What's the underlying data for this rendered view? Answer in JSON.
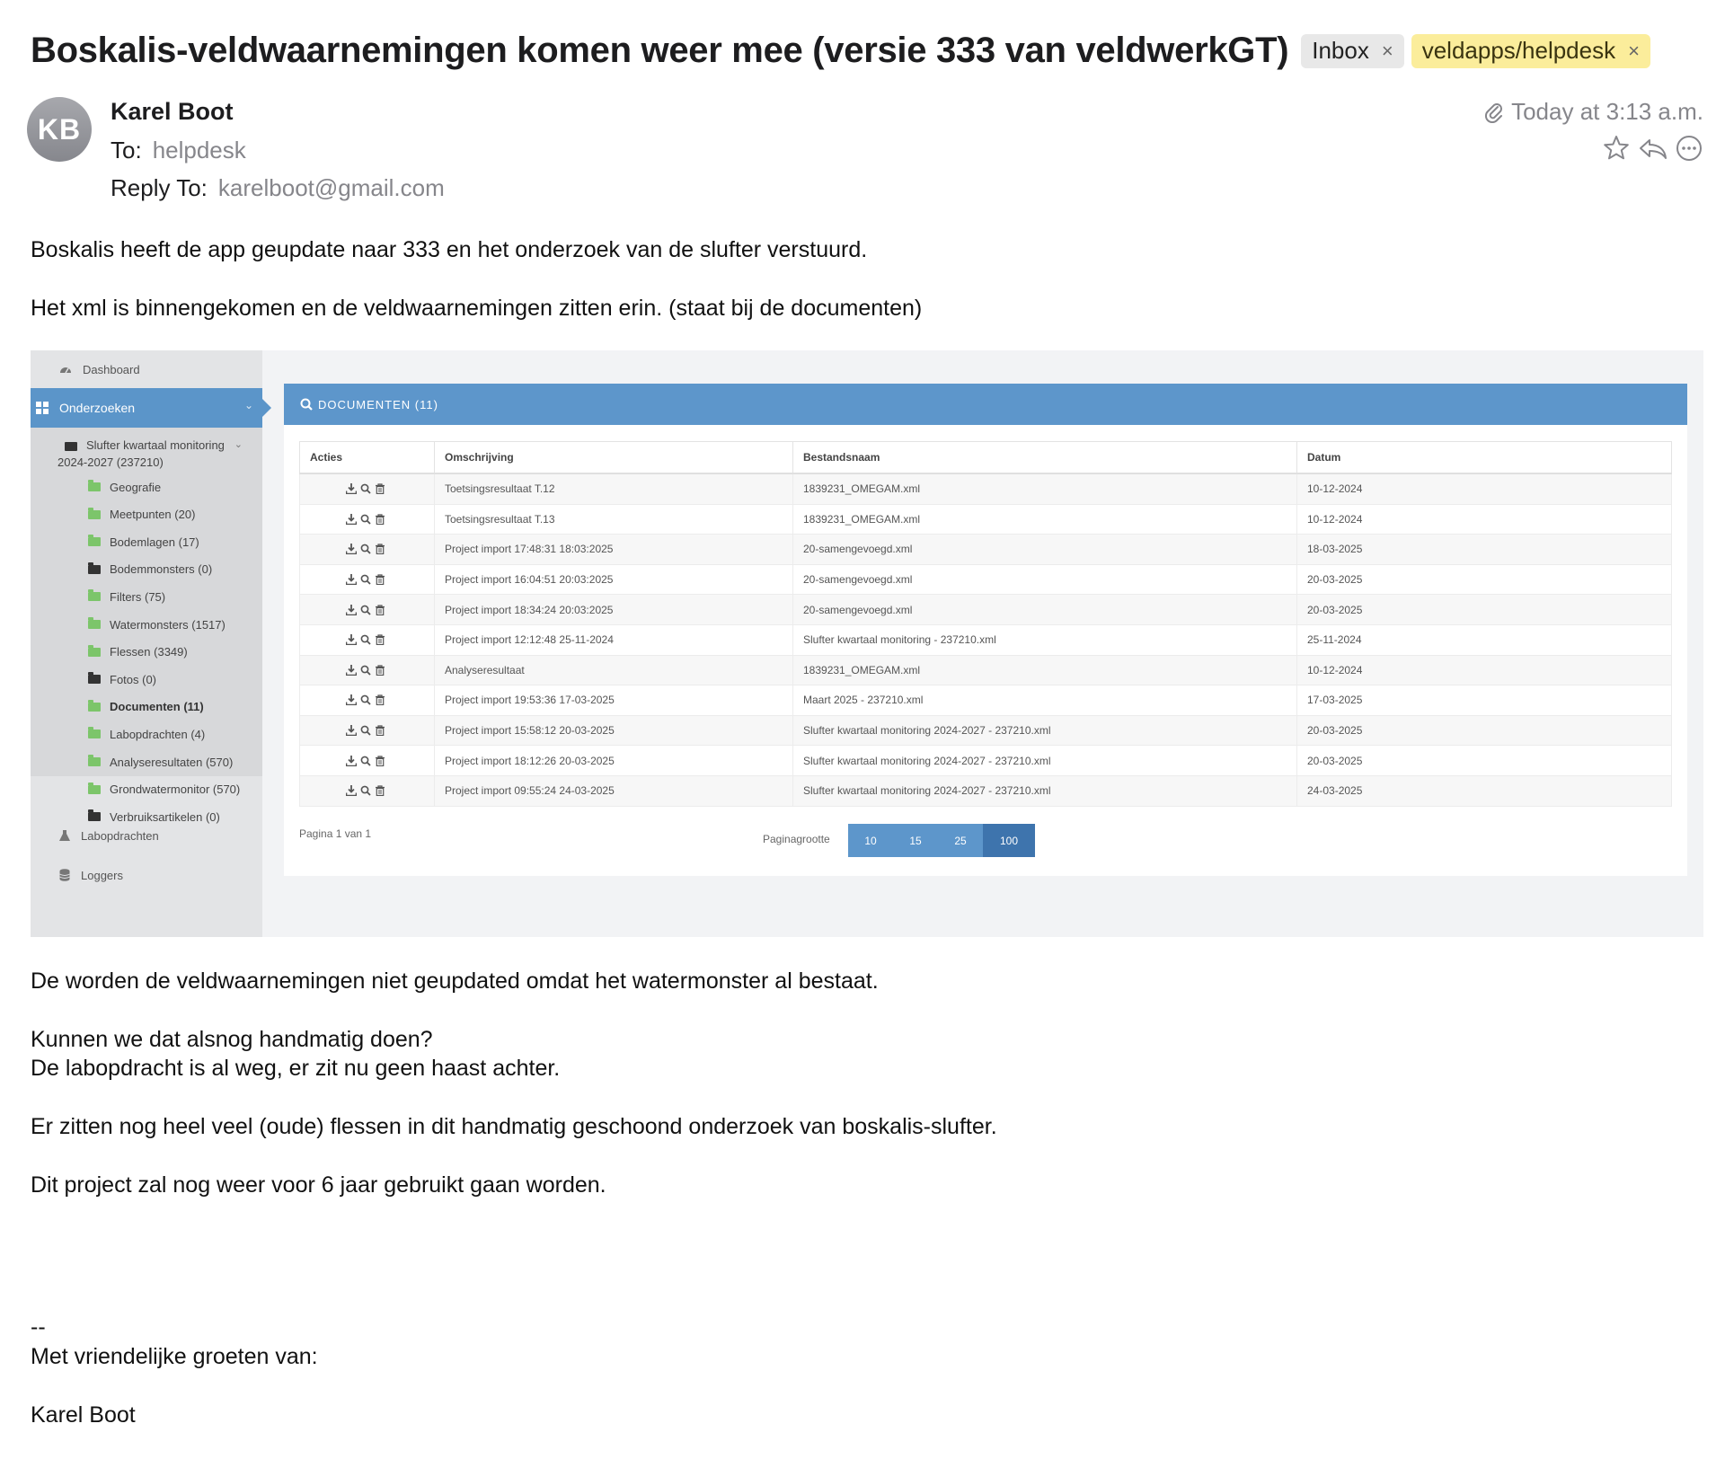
{
  "email": {
    "subject": "Boskalis-veldwaarnemingen komen weer mee (versie 333 van veldwerkGT)",
    "tags": [
      {
        "label": "Inbox",
        "close": "×"
      },
      {
        "label": "veldapps/helpdesk",
        "close": "×",
        "color": "#fbed9b"
      }
    ],
    "avatar_initials": "KB",
    "sender": "Karel Boot",
    "to_label": "To:",
    "to_value": "helpdesk",
    "reply_to_label": "Reply To:",
    "reply_to_value": "karelboot@gmail.com",
    "date": "Today at 3:13 a.m.",
    "icons": [
      "paperclip-icon",
      "star-icon",
      "reply-icon",
      "more-icon"
    ],
    "body_top": [
      "Boskalis heeft de app geupdate naar 333 en het onderzoek van de slufter verstuurd.",
      "Het xml is binnengekomen en de veldwaarnemingen zitten erin. (staat bij de documenten)"
    ],
    "body_bottom": [
      "De worden de veldwaarnemingen niet geupdated omdat het watermonster al bestaat.",
      "Kunnen we dat alsnog handmatig doen?",
      "De labopdracht is al weg, er zit nu geen haast achter.",
      "Er zitten nog heel veel (oude) flessen in dit handmatig geschoond onderzoek van boskalis-slufter.",
      "Dit project zal nog weer voor 6 jaar gebruikt gaan worden."
    ],
    "signature": {
      "separator": "--",
      "greeting": "Met vriendelijke groeten van:",
      "name": "Karel Boot"
    }
  },
  "screenshot": {
    "sidebar": {
      "dashboard": "Dashboard",
      "onderzoeken": "Onderzoeken",
      "project": "Slufter kwartaal monitoring 2024-2027 (237210)",
      "items": [
        {
          "label": "Geografie",
          "folder": "green"
        },
        {
          "label": "Meetpunten (20)",
          "folder": "green"
        },
        {
          "label": "Bodemlagen (17)",
          "folder": "green"
        },
        {
          "label": "Bodemmonsters (0)",
          "folder": "black"
        },
        {
          "label": "Filters (75)",
          "folder": "green"
        },
        {
          "label": "Watermonsters (1517)",
          "folder": "green"
        },
        {
          "label": "Flessen (3349)",
          "folder": "green"
        },
        {
          "label": "Fotos (0)",
          "folder": "black"
        },
        {
          "label": "Documenten (11)",
          "folder": "green",
          "active": true
        },
        {
          "label": "Labopdrachten (4)",
          "folder": "green"
        },
        {
          "label": "Analyseresultaten (570)",
          "folder": "green"
        },
        {
          "label": "Grondwatermonitor (570)",
          "folder": "green"
        },
        {
          "label": "Verbruiksartikelen (0)",
          "folder": "black"
        }
      ],
      "labopdrachten": "Labopdrachten",
      "loggers": "Loggers"
    },
    "panel_title": "DOCUMENTEN (11)",
    "table": {
      "headers": [
        "Acties",
        "Omschrijving",
        "Bestandsnaam",
        "Datum"
      ],
      "rows": [
        [
          "Toetsingsresultaat T.12",
          "1839231_OMEGAM.xml",
          "10-12-2024"
        ],
        [
          "Toetsingsresultaat T.13",
          "1839231_OMEGAM.xml",
          "10-12-2024"
        ],
        [
          "Project import 17:48:31 18:03:2025",
          "20-samengevoegd.xml",
          "18-03-2025"
        ],
        [
          "Project import 16:04:51 20:03:2025",
          "20-samengevoegd.xml",
          "20-03-2025"
        ],
        [
          "Project import 18:34:24 20:03:2025",
          "20-samengevoegd.xml",
          "20-03-2025"
        ],
        [
          "Project import 12:12:48 25-11-2024",
          "Slufter kwartaal monitoring - 237210.xml",
          "25-11-2024"
        ],
        [
          "Analyseresultaat",
          "1839231_OMEGAM.xml",
          "10-12-2024"
        ],
        [
          "Project import 19:53:36 17-03-2025",
          "Maart 2025 - 237210.xml",
          "17-03-2025"
        ],
        [
          "Project import 15:58:12 20-03-2025",
          "Slufter kwartaal monitoring 2024-2027 - 237210.xml",
          "20-03-2025"
        ],
        [
          "Project import 18:12:26 20-03-2025",
          "Slufter kwartaal monitoring 2024-2027 - 237210.xml",
          "20-03-2025"
        ],
        [
          "Project import 09:55:24 24-03-2025",
          "Slufter kwartaal monitoring 2024-2027 - 237210.xml",
          "24-03-2025"
        ]
      ],
      "row_action_icons": [
        "download-icon",
        "view-icon",
        "delete-icon"
      ]
    },
    "pager_text": "Pagina 1 van 1",
    "page_size_label": "Paginagrootte",
    "page_sizes": [
      "10",
      "15",
      "25",
      "100"
    ],
    "page_size_selected": "100",
    "accent_color": "#5d96cb"
  }
}
